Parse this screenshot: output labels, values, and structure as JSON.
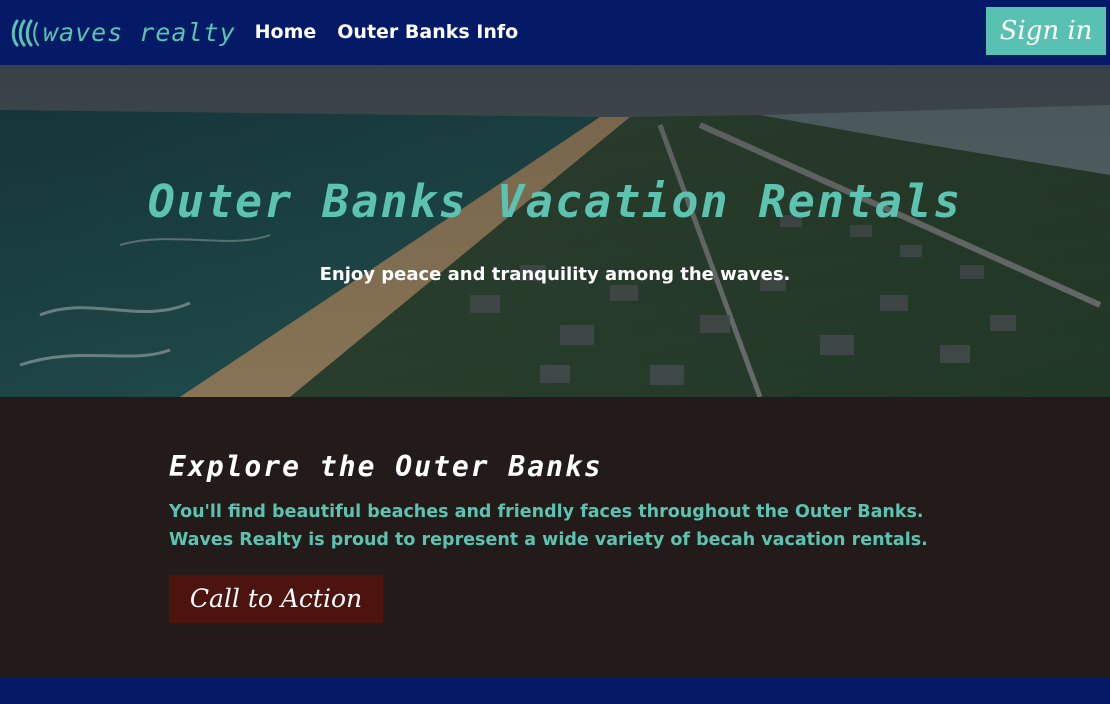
{
  "nav": {
    "brand_text": "waves realty",
    "brand_icon": "wave-logo-icon",
    "links": [
      "Home",
      "Outer Banks Info"
    ],
    "signin_label": "Sign in"
  },
  "hero": {
    "title": "Outer Banks Vacation Rentals",
    "subtitle": "Enjoy peace and tranquility among the waves."
  },
  "section": {
    "title": "Explore the Outer Banks",
    "body": "You'll find beautiful beaches and friendly faces throughout the Outer Banks. Waves Realty is proud to represent a wide variety of becah vacation rentals.",
    "cta_label": "Call to Action"
  },
  "colors": {
    "navy": "#041a66",
    "teal": "#5cc3b1",
    "dark_bg": "#231b1a",
    "cta_bg": "#4d140f"
  }
}
